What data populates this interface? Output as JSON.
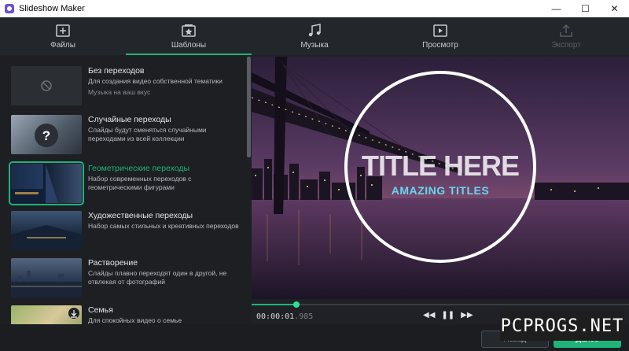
{
  "window": {
    "title": "Slideshow Maker",
    "controls": [
      "—",
      "☐",
      "✕"
    ]
  },
  "nav": {
    "tabs": [
      {
        "label": "Файлы",
        "icon": "add-file-icon",
        "state": "normal"
      },
      {
        "label": "Шаблоны",
        "icon": "templates-icon",
        "state": "active"
      },
      {
        "label": "Музыка",
        "icon": "music-note-icon",
        "state": "normal"
      },
      {
        "label": "Просмотр",
        "icon": "play-preview-icon",
        "state": "normal"
      },
      {
        "label": "Экспорт",
        "icon": "export-icon",
        "state": "disabled"
      }
    ]
  },
  "templates": [
    {
      "name": "Без переходов",
      "desc": "Для создания видео собственной тематики",
      "note": "Музыка на ваш вкус",
      "thumb": "none-icon"
    },
    {
      "name": "Случайные переходы",
      "desc": "Слайды будут сменяться случайными переходами из всей коллекции",
      "thumb": "question-icon"
    },
    {
      "name": "Геометрические переходы",
      "desc": "Набор современных переходов с геометрическими фигурами",
      "thumb": "geometric",
      "selected": true
    },
    {
      "name": "Художественные переходы",
      "desc": "Набор самых стильных и креативных переходов",
      "thumb": "artistic"
    },
    {
      "name": "Растворение",
      "desc": "Слайды плавно переходят один в другой, не отвлекая от фотографий",
      "thumb": "dissolve"
    },
    {
      "name": "Семья",
      "desc": "Для спокойных видео о семье",
      "thumb": "family"
    }
  ],
  "preview": {
    "title_text": "TITLE HERE",
    "subtitle_text": "AMAZING TITLES",
    "progress": 0.118
  },
  "player": {
    "time_main": "00:00:01",
    "time_ms": ".985",
    "prev_icon": "◀◀",
    "pause_icon": "❚❚",
    "next_icon": "▶▶"
  },
  "footer": {
    "back_label": "Назад",
    "next_label": "Далее"
  },
  "watermark": "PCPROGS.NET",
  "colors": {
    "accent": "#1fb37a",
    "background": "#1f2125"
  }
}
